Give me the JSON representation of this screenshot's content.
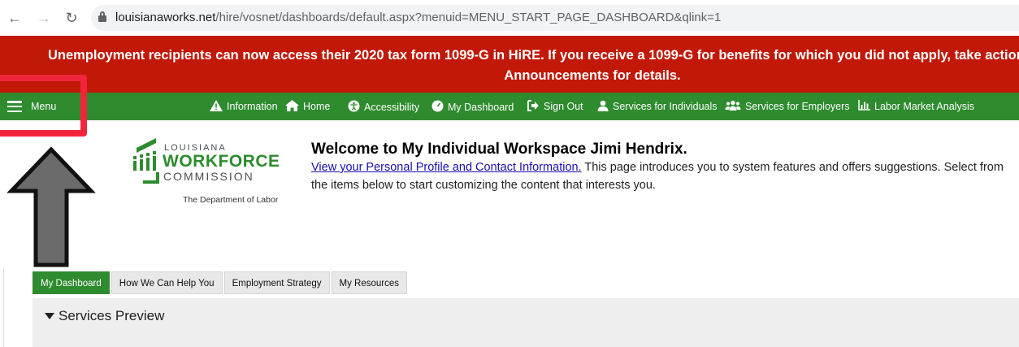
{
  "browser": {
    "back_icon": "arrow-left-icon",
    "forward_icon": "arrow-right-icon",
    "reload_icon": "reload-icon",
    "url_host": "louisianaworks.net",
    "url_path": "/hire/vosnet/dashboards/default.aspx?menuid=MENU_START_PAGE_DASHBOARD&qlink=1"
  },
  "banner": {
    "line1": "Unemployment recipients can now access their 2020 tax form 1099-G in HiRE. If you receive a 1099-G for benefits for which you did not apply, take action",
    "line2": "Announcements for details."
  },
  "navbar": {
    "menu_label": "Menu",
    "items": [
      {
        "label": "Information",
        "icon": "warning-icon"
      },
      {
        "label": "Home",
        "icon": "home-icon"
      },
      {
        "label": "Accessibility",
        "icon": "accessibility-icon"
      },
      {
        "label": "My Dashboard",
        "icon": "dashboard-icon"
      },
      {
        "label": "Sign Out",
        "icon": "sign-out-icon"
      },
      {
        "label": "Services for Individuals",
        "icon": "user-icon"
      },
      {
        "label": "Services for Employers",
        "icon": "users-icon"
      },
      {
        "label": "Labor Market Analysis",
        "icon": "bar-chart-icon"
      }
    ],
    "accent": "#2e8b2e"
  },
  "logo": {
    "line1": "LOUISIANA",
    "line2": "WORKFORCE",
    "line3": "COMMISSION",
    "tagline": "The Department of Labor"
  },
  "welcome": {
    "heading": "Welcome to My Individual Workspace Jimi Hendrix.",
    "link_text": "View your Personal Profile and Contact Information.",
    "body_text": " This page introduces you to system features and offers suggestions. Select from the items below to start customizing the content that interests you."
  },
  "tabs": [
    {
      "label": "My Dashboard",
      "active": true
    },
    {
      "label": "How We Can Help You",
      "active": false
    },
    {
      "label": "Employment Strategy",
      "active": false
    },
    {
      "label": "My Resources",
      "active": false
    }
  ],
  "services_preview": {
    "title": "Services Preview"
  },
  "colors": {
    "banner": "#c21807",
    "highlight": "#f0253b"
  }
}
